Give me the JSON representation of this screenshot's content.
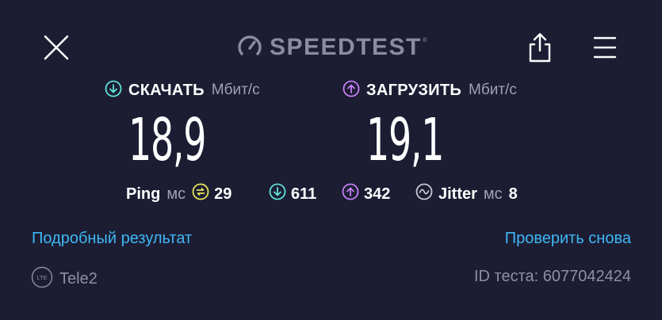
{
  "header": {
    "logo_text": "SPEEDTEST",
    "logo_mark": "®",
    "icons": {
      "close": "close-icon",
      "share": "share-icon",
      "menu": "menu-icon",
      "gauge": "gauge-icon"
    }
  },
  "download": {
    "label": "СКАЧАТЬ",
    "unit": "Мбит/с",
    "value": "18,9"
  },
  "upload": {
    "label": "ЗАГРУЗИТЬ",
    "unit": "Мбит/с",
    "value": "19,1"
  },
  "stats": {
    "ping_label": "Ping",
    "ping_unit": "мс",
    "ping_idle": "29",
    "ping_download": "611",
    "ping_upload": "342",
    "jitter_label": "Jitter",
    "jitter_unit": "мс",
    "jitter_value": "8"
  },
  "links": {
    "detail": "Подробный результат",
    "retest": "Проверить снова"
  },
  "footer": {
    "network_type": "LTE",
    "provider": "Tele2",
    "test_id": "ID теста: 6077042424"
  },
  "colors": {
    "background": "#1c1d33",
    "download_accent": "#5fe1d9",
    "upload_accent": "#c47ff5",
    "idle_accent": "#e6e35b",
    "link": "#3fb7f4",
    "muted": "#8e8fa3"
  }
}
